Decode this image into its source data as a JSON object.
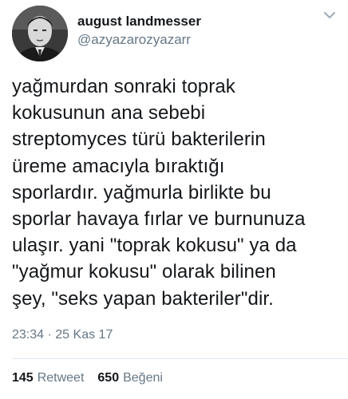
{
  "user": {
    "display_name": "august landmesser",
    "handle": "@azyazarozyazarr"
  },
  "tweet": {
    "lines": [
      "yağmurdan sonraki toprak",
      "kokusunun ana sebebi",
      "streptomyces türü bakterilerin",
      "üreme amacıyla bıraktığı",
      "sporlardır. yağmurla birlikte bu",
      "sporlar havaya fırlar ve burnunuza",
      "ulaşır. yani \"toprak kokusu\" ya da",
      "\"yağmur kokusu\" olarak bilinen",
      "şey, \"seks yapan bakteriler\"dir."
    ],
    "time": "23:34",
    "separator": "·",
    "date": "25 Kas 17"
  },
  "stats": {
    "retweets_count": "145",
    "retweets_label": "Retweet",
    "likes_count": "650",
    "likes_label": "Beğeni"
  },
  "icons": {
    "more": "chevron-down-icon"
  },
  "colors": {
    "text": "#14171a",
    "secondary": "#657786",
    "divider": "#e1e8ed"
  }
}
